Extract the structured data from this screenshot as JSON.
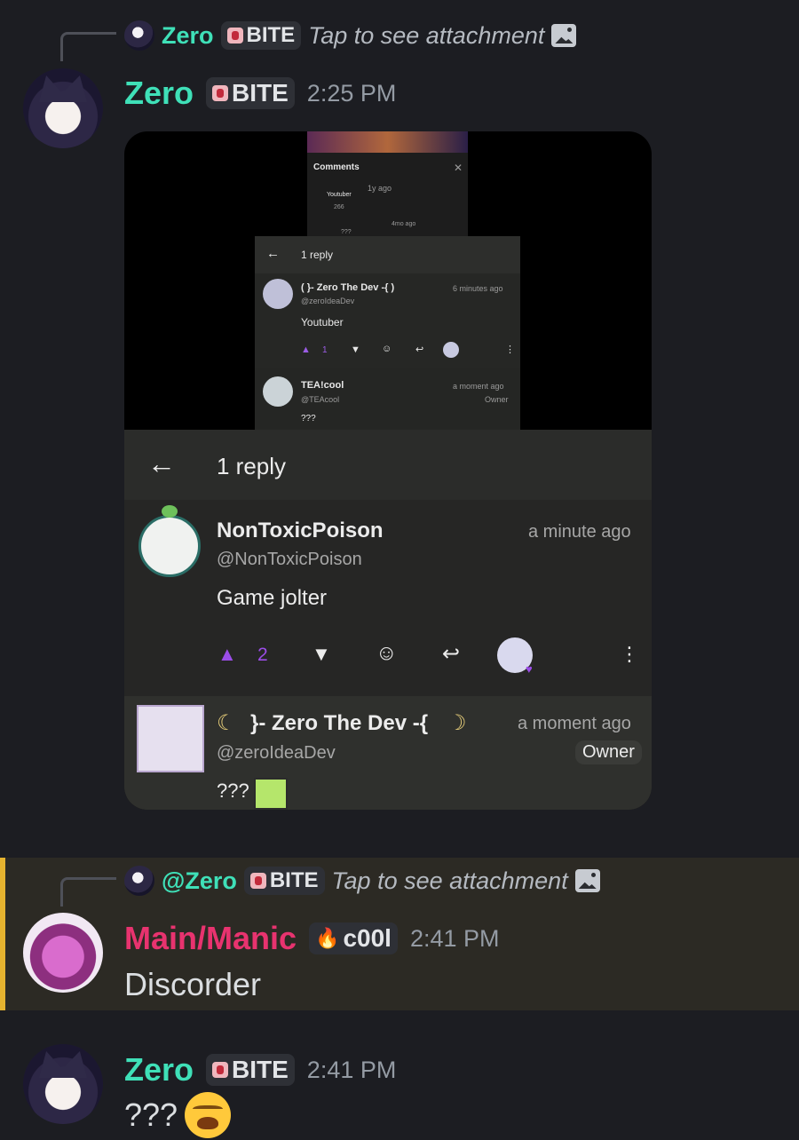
{
  "msg1": {
    "reply": {
      "name": "Zero",
      "tag": "BITE",
      "text": "Tap to see attachment"
    },
    "author": "Zero",
    "author_color": "#3fe0b8",
    "tag": "BITE",
    "time": "2:25 PM",
    "attachment": {
      "small_top": {
        "comments_label": "Comments",
        "reply_text": "Youtuber",
        "likes": "266",
        "tiny_ts1": "1y ago",
        "tiny_ts2": "4mo ago",
        "tiny_comment": "???"
      },
      "small_panel": {
        "header": "1 reply",
        "c1": {
          "name": "( }- Zero The Dev -{ )",
          "handle": "@zeroIdeaDev",
          "time": "6 minutes ago",
          "text": "Youtuber",
          "likes": "1"
        },
        "c2": {
          "name": "TEA!cool",
          "handle": "@TEAcool",
          "time": "a moment ago",
          "badge": "Owner",
          "text": "???"
        }
      },
      "big": {
        "header": "1 reply",
        "c1": {
          "name": "NonToxicPoison",
          "handle": "@NonToxicPoison",
          "time": "a minute ago",
          "text": "Game jolter",
          "likes": "2"
        },
        "c2": {
          "name": "}- Zero The Dev -{",
          "handle": "@zeroIdeaDev",
          "time": "a moment ago",
          "badge": "Owner",
          "text": "???"
        }
      }
    }
  },
  "msg2": {
    "reply": {
      "name": "@Zero",
      "tag": "BITE",
      "text": "Tap to see attachment"
    },
    "author": "Main/Manic",
    "author_color": "#e8336f",
    "tag": "c00l",
    "time": "2:41 PM",
    "text": "Discorder"
  },
  "msg3": {
    "author": "Zero",
    "author_color": "#3fe0b8",
    "tag": "BITE",
    "time": "2:41 PM",
    "text": "???"
  }
}
